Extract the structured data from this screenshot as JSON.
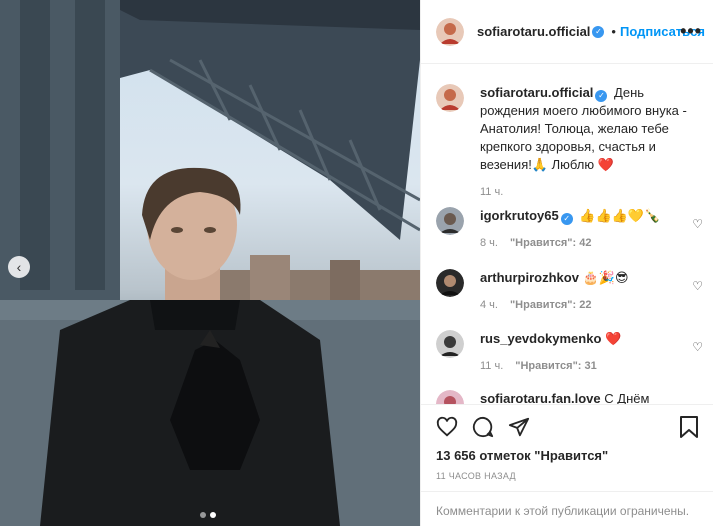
{
  "post": {
    "username": "sofiarotaru.official",
    "follow_label": "Подписаться",
    "more_label": "•••",
    "caption": {
      "username": "sofiarotaru.official",
      "text": "День рождения моего любимого внука - Анатолия! Толюца, желаю тебе крепкого здоровья, счастья и везения!🙏 Люблю ❤️",
      "time": "11 ч."
    },
    "comments": [
      {
        "username": "igorkrutoy65",
        "verified": true,
        "text": "👍👍👍💛🍾",
        "time": "8 ч.",
        "likes": "\"Нравится\": 42"
      },
      {
        "username": "arthurpirozhkov",
        "verified": false,
        "text": "🎂🎉😎",
        "time": "4 ч.",
        "likes": "\"Нравится\": 22"
      },
      {
        "username": "rus_yevdokymenko",
        "verified": false,
        "text": "❤️",
        "time": "11 ч.",
        "likes": "\"Нравится\": 31"
      },
      {
        "username": "sofiarotaru.fan.love",
        "verified": false,
        "text": "С Днём",
        "time": "",
        "likes": ""
      }
    ],
    "likes_count": "13 656 отметок \"Нравится\"",
    "time_ago": "11 ЧАСОВ НАЗАД",
    "comments_restricted": "Комментарии к этой публикации ограничены."
  },
  "icons": {
    "like": "heart-icon",
    "comment": "comment-icon",
    "share": "share-icon",
    "save": "bookmark-icon",
    "prev": "chevron-left-icon"
  },
  "colors": {
    "accent": "#0095f6",
    "verified": "#3897f0",
    "muted": "#8e8e8e",
    "text": "#262626"
  }
}
